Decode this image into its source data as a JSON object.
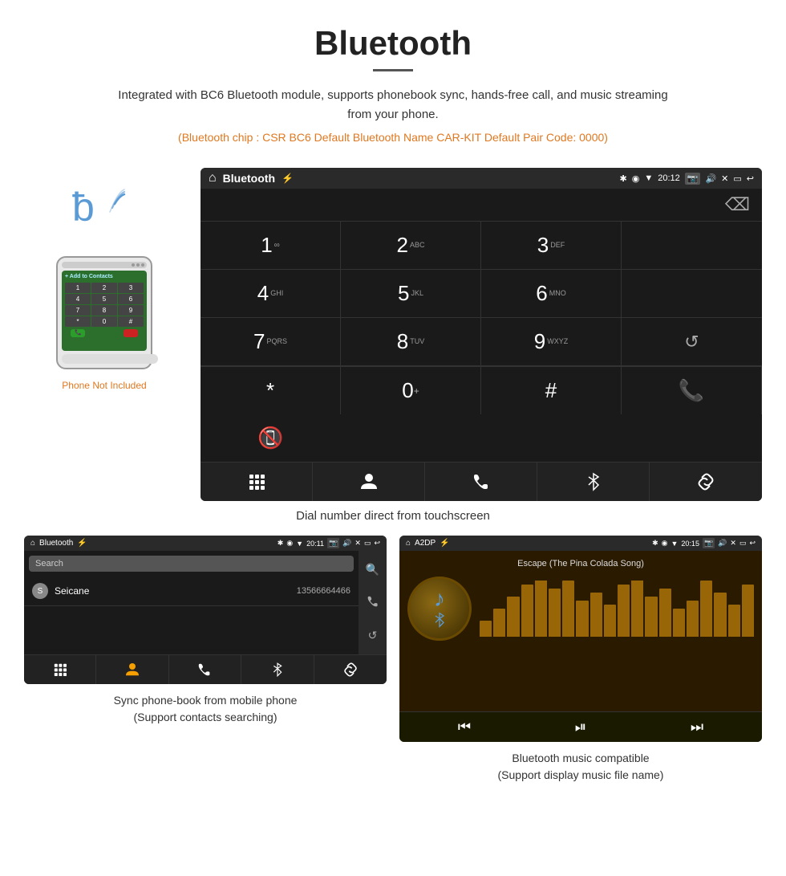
{
  "page": {
    "title": "Bluetooth",
    "description": "Integrated with BC6 Bluetooth module, supports phonebook sync, hands-free call, and music streaming from your phone.",
    "bluetooth_info": "(Bluetooth chip : CSR BC6    Default Bluetooth Name CAR-KIT    Default Pair Code: 0000)",
    "main_caption": "Dial number direct from touchscreen",
    "bottom_left_caption_line1": "Sync phone-book from mobile phone",
    "bottom_left_caption_line2": "(Support contacts searching)",
    "bottom_right_caption_line1": "Bluetooth music compatible",
    "bottom_right_caption_line2": "(Support display music file name)",
    "phone_not_included": "Phone Not Included"
  },
  "dial_screen": {
    "status_bar": {
      "title": "Bluetooth",
      "time": "20:12"
    },
    "keys": [
      {
        "num": "1",
        "letters": "∞"
      },
      {
        "num": "2",
        "letters": "ABC"
      },
      {
        "num": "3",
        "letters": "DEF"
      },
      {
        "num": "",
        "letters": ""
      },
      {
        "num": "4",
        "letters": "GHI"
      },
      {
        "num": "5",
        "letters": "JKL"
      },
      {
        "num": "6",
        "letters": "MNO"
      },
      {
        "num": "",
        "letters": ""
      },
      {
        "num": "7",
        "letters": "PQRS"
      },
      {
        "num": "8",
        "letters": "TUV"
      },
      {
        "num": "9",
        "letters": "WXYZ"
      },
      {
        "num": "",
        "letters": ""
      },
      {
        "num": "*",
        "letters": ""
      },
      {
        "num": "0",
        "letters": "+"
      },
      {
        "num": "#",
        "letters": ""
      },
      {
        "num": "",
        "letters": ""
      }
    ]
  },
  "phonebook_screen": {
    "status_bar": {
      "title": "Bluetooth",
      "time": "20:11"
    },
    "search_placeholder": "Search",
    "contact": {
      "letter": "S",
      "name": "Seicane",
      "number": "13566664466"
    }
  },
  "music_screen": {
    "status_bar": {
      "title": "A2DP",
      "time": "20:15"
    },
    "song_title": "Escape (The Pina Colada Song)",
    "eq_bars": [
      20,
      35,
      50,
      65,
      80,
      60,
      70,
      45,
      55,
      40,
      65,
      75,
      50,
      60,
      35,
      45,
      70,
      55,
      40,
      65
    ]
  },
  "icons": {
    "home": "⌂",
    "usb": "⚡",
    "bluetooth": "✱",
    "location": "◉",
    "wifi": "▼",
    "camera": "📷",
    "volume": "🔊",
    "close": "✕",
    "window": "▭",
    "back": "↩",
    "backspace": "⌫",
    "reload": "↺",
    "call_green": "📞",
    "call_red": "📵",
    "grid": "⊞",
    "person": "👤",
    "phone": "☎",
    "bt": "❋",
    "link": "🔗",
    "search": "🔍",
    "prev": "⏮",
    "play": "⏯",
    "next": "⏭",
    "star": "★",
    "hash": "#"
  }
}
